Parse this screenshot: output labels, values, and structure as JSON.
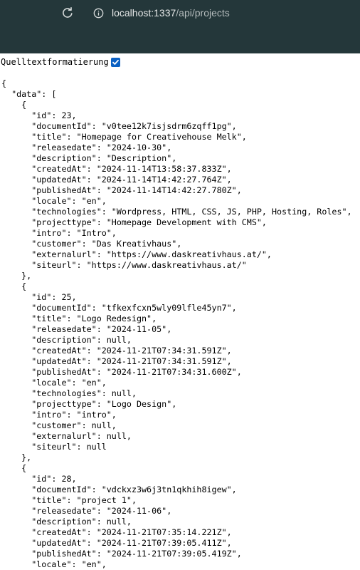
{
  "browser": {
    "url_host": "localhost:1337",
    "url_path": "/api/projects",
    "bar_color": "#24373a"
  },
  "viewer": {
    "pretty_print_label": "Quelltextformatierung",
    "pretty_print_checked": true,
    "accent_color": "#0b61c3"
  },
  "json_lines": [
    "{",
    "  \"data\": [",
    "    {",
    "      \"id\": 23,",
    "      \"documentId\": \"v0tee12k7isjsdrm6zqff1pg\",",
    "      \"title\": \"Homepage for Creativehouse Melk\",",
    "      \"releasedate\": \"2024-10-30\",",
    "      \"description\": \"Description\",",
    "      \"createdAt\": \"2024-11-14T13:58:37.833Z\",",
    "      \"updatedAt\": \"2024-11-14T14:42:27.764Z\",",
    "      \"publishedAt\": \"2024-11-14T14:42:27.780Z\",",
    "      \"locale\": \"en\",",
    "      \"technologies\": \"Wordpress, HTML, CSS, JS, PHP, Hosting, Roles\",",
    "      \"projecttype\": \"Homepage Development with CMS\",",
    "      \"intro\": \"Intro\",",
    "      \"customer\": \"Das Kreativhaus\",",
    "      \"externalurl\": \"https://www.daskreativhaus.at/\",",
    "      \"siteurl\": \"https://www.daskreativhaus.at/\"",
    "    },",
    "    {",
    "      \"id\": 25,",
    "      \"documentId\": \"tfkexfcxn5wly09lfle45yn7\",",
    "      \"title\": \"Logo Redesign\",",
    "      \"releasedate\": \"2024-11-05\",",
    "      \"description\": null,",
    "      \"createdAt\": \"2024-11-21T07:34:31.591Z\",",
    "      \"updatedAt\": \"2024-11-21T07:34:31.591Z\",",
    "      \"publishedAt\": \"2024-11-21T07:34:31.600Z\",",
    "      \"locale\": \"en\",",
    "      \"technologies\": null,",
    "      \"projecttype\": \"Logo Design\",",
    "      \"intro\": \"intro\",",
    "      \"customer\": null,",
    "      \"externalurl\": null,",
    "      \"siteurl\": null",
    "    },",
    "    {",
    "      \"id\": 28,",
    "      \"documentId\": \"vdckxz3w6j3tn1qkhih8igew\",",
    "      \"title\": \"project 1\",",
    "      \"releasedate\": \"2024-11-06\",",
    "      \"description\": null,",
    "      \"createdAt\": \"2024-11-21T07:35:14.221Z\",",
    "      \"updatedAt\": \"2024-11-21T07:39:05.411Z\",",
    "      \"publishedAt\": \"2024-11-21T07:39:05.419Z\",",
    "      \"locale\": \"en\","
  ]
}
